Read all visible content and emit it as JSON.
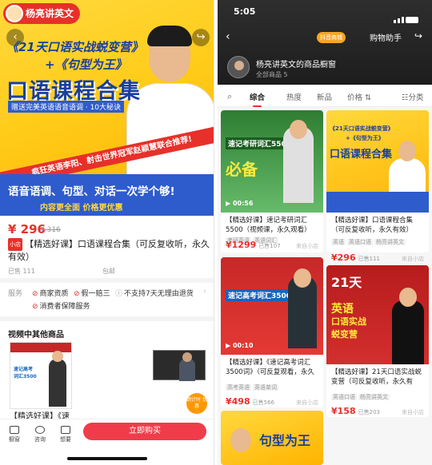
{
  "left": {
    "hero": {
      "logo_text": "杨亮讲英文",
      "line1": "《21天口语实战蜕变营》",
      "line2": "+《句型为王》",
      "line3": "口语课程合集",
      "line4": "赠送完美英语语音语调 · 10大秘诀",
      "slant_text": "疯狂英语李阳、射击世界冠军赵颖慧联合推荐!",
      "bottom_line1": "语音语调、句型、对话一次学个够!",
      "bottom_line2": "内容更全面 价格更优惠"
    },
    "price": "¥ 296",
    "old_price": "¥ 316",
    "tag_label": "小店",
    "product_title": "【精选好课】口语课程合集（可反复收听，永久有效）",
    "sold": "已售 111",
    "shipping": "包邮",
    "service_label": "服务",
    "services": [
      {
        "icon": "check-circle-icon",
        "text": "商家资质"
      },
      {
        "icon": "check-circle-icon",
        "text": "假一赔三"
      },
      {
        "icon": "info-circle-icon",
        "text": "不支持7天无理由退货"
      },
      {
        "icon": "check-circle-icon",
        "text": "消费者保障服务"
      }
    ],
    "video_section_title": "视频中其他商品",
    "video_card_caption": "【精选好课】《速",
    "badge_text": "倒计时 优惠",
    "bottom": {
      "shop": "橱窗",
      "chat": "咨询",
      "want": "想要",
      "buy": "立即购买"
    }
  },
  "right": {
    "time": "5:05",
    "badge": "抖音商城",
    "helper": "购物助手",
    "shop_name": "杨亮讲英文的商品橱窗",
    "shop_count": "全部商品 5",
    "tabs": [
      "综合",
      "热度",
      "新品",
      "价格 ⇅",
      "分类"
    ],
    "cards": [
      {
        "title": "【精选好课】速记考研词汇5500（视频课，永久观看）",
        "tags": [
          "考研英语",
          "英语词汇"
        ],
        "price": "¥1299",
        "sold": "已售107",
        "from": "来自小店",
        "img_text": [
          "速记考研词汇5500",
          "必备"
        ],
        "duration": "00:56"
      },
      {
        "title": "【精选好课】口语课程合集（可反复收听，永久有效）",
        "tags": [
          "英语",
          "英语口语",
          "杨亮讲英文"
        ],
        "price": "¥296",
        "sold": "已售111",
        "from": "来自小店",
        "img_text": [
          "《21天口语实战蜕变营》",
          "+《句型为王》",
          "口语课程合集"
        ]
      },
      {
        "title": "【精选好课】《速记高考词汇3500词》（可反复观看，永久",
        "tags": [
          "高考英语",
          "英语单词"
        ],
        "price": "¥498",
        "sold": "已售566",
        "from": "来自小店",
        "img_text": [
          "速记高考词汇3500"
        ],
        "duration": "00:10"
      },
      {
        "title": "【精选好课】21天口语实战蜕变营（可反复收听，永久有",
        "tags": [
          "英语口语",
          "杨亮讲英文"
        ],
        "price": "¥158",
        "sold": "已售203",
        "from": "来自小店",
        "img_text": [
          "21天",
          "英语",
          "口语实战",
          "蜕变营"
        ]
      },
      {
        "img_text": [
          "句型为王"
        ]
      }
    ]
  },
  "colors": {
    "accent_red": "#e8302a",
    "hero_yellow": "#ffcc1a",
    "hero_blue": "#1b3f9e",
    "buy_button": "#f03c4a"
  }
}
